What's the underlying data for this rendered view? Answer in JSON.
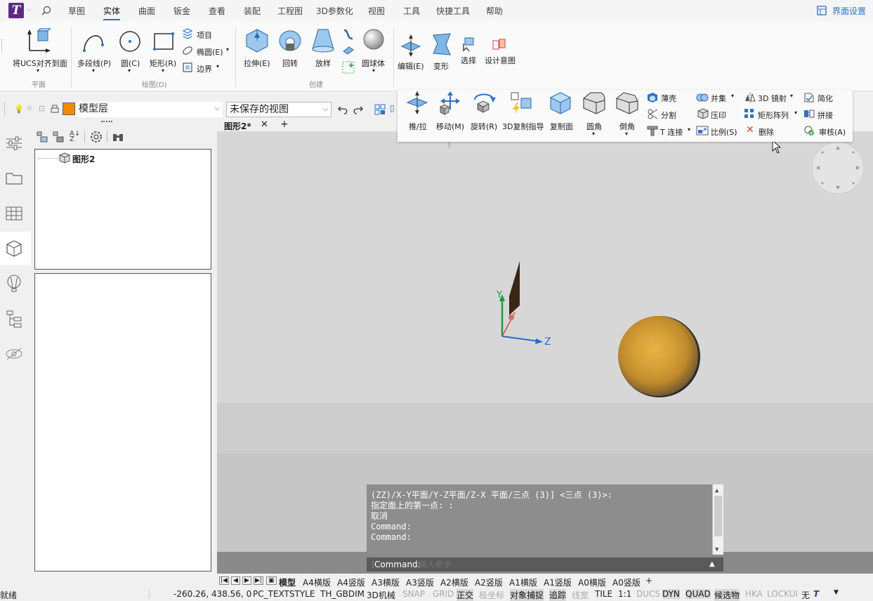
{
  "menubar": {
    "logo": "T",
    "tabs": [
      "草图",
      "实体",
      "曲面",
      "钣金",
      "查看",
      "装配",
      "工程图",
      "3D参数化",
      "视图",
      "工具",
      "快捷工具",
      "帮助"
    ],
    "active_tab": "实体",
    "ui_settings": "界面设置"
  },
  "ribbon": {
    "ucs": "将UCS对齐到面",
    "polyline": "多段线(P)",
    "circle": "圆(C)",
    "rect": "矩形(R)",
    "item": "项目",
    "ellipse": "椭圆(E)",
    "border": "边界",
    "extrude": "拉伸(E)",
    "revolve": "回转",
    "loft": "放样",
    "sphere": "圆球体",
    "edit": "编辑(E)",
    "deform": "变形",
    "select": "选择",
    "design_intent": "设计意图",
    "groups": {
      "plane": "平面",
      "draw": "绘图(D)",
      "create": "创建"
    }
  },
  "floatpanel": {
    "push_pull": "推/拉",
    "move": "移动(M)",
    "rotate": "旋转(R)",
    "copy3d": "3D复制指导",
    "copy_face": "复制面",
    "fillet": "圆角",
    "chamfer": "倒角",
    "shell": "薄壳",
    "split": "分割",
    "tjoin": "T 连接",
    "union": "并集",
    "imprint": "压印",
    "scale": "比例(S)",
    "mirror3d": "3D 镜射",
    "rect_array": "矩形阵列",
    "delete": "删除",
    "simplify": "简化",
    "stitch": "拼接",
    "audit": "审核(A)"
  },
  "toolbar2": {
    "layer": "模型层",
    "view": "未保存的视图",
    "layer_color": "#f28a00"
  },
  "doc_tab": "图形2*",
  "tree": {
    "root": "图形2"
  },
  "viewport": {
    "axis_y": "Y",
    "axis_z": "Z"
  },
  "command": {
    "history": [
      "(ZZ)/X-Y平面/Y-Z平面/Z-X 平面/三点 (3)] <三点 (3)>:",
      "指定面上的第一点:  :",
      "取消",
      "Command:",
      "Command:"
    ],
    "prompt": "Command:",
    "placeholder": "输入命令"
  },
  "layout_tabs": [
    "模型",
    "A4横版",
    "A4竖版",
    "A3横版",
    "A3竖版",
    "A2横版",
    "A2竖版",
    "A1横版",
    "A1竖版",
    "A0横版",
    "A0竖版",
    "+"
  ],
  "status": {
    "ready": "就绪",
    "coords": "-260.26, 438.56, 0",
    "items": [
      {
        "label": "PC_TEXTSTYLE",
        "state": "plain"
      },
      {
        "label": "TH_GBDIM",
        "state": "plain"
      },
      {
        "label": "3D机械",
        "state": "plain"
      },
      {
        "label": "SNAP",
        "state": "off"
      },
      {
        "label": "GRID",
        "state": "off"
      },
      {
        "label": "正交",
        "state": "on"
      },
      {
        "label": "极坐标",
        "state": "off"
      },
      {
        "label": "对象捕捉",
        "state": "on"
      },
      {
        "label": "追踪",
        "state": "on"
      },
      {
        "label": "线宽",
        "state": "off"
      },
      {
        "label": "TILE",
        "state": "plain"
      },
      {
        "label": "1:1",
        "state": "plain"
      },
      {
        "label": "DUCS",
        "state": "off"
      },
      {
        "label": "DYN",
        "state": "on"
      },
      {
        "label": "QUAD",
        "state": "on"
      },
      {
        "label": "候选物",
        "state": "on"
      },
      {
        "label": "HKA",
        "state": "off"
      },
      {
        "label": "LOCKUI",
        "state": "off"
      },
      {
        "label": "无",
        "state": "plain"
      }
    ]
  },
  "colors": {
    "accent": "#2b74c7",
    "sphere": "#c9922e",
    "logo": "#5b2a86"
  }
}
